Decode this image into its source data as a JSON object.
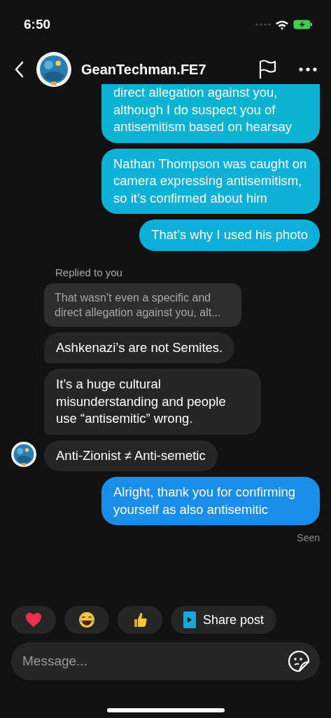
{
  "status_bar": {
    "time": "6:50"
  },
  "header": {
    "name": "GeanTechman.FE7"
  },
  "messages": [
    {
      "kind": "sent",
      "cut_off": true,
      "color": "#0bb3d3",
      "text": "direct allegation against you, although I do suspect you of antisemitism based on hearsay"
    },
    {
      "kind": "sent",
      "cut_off": false,
      "color": "#0bb1d6",
      "text": "Nathan Thompson was caught on camera expressing antisemitism, so it’s confirmed about him"
    },
    {
      "kind": "sent",
      "cut_off": false,
      "color": "#0bafd8",
      "text": "That’s why I used his photo"
    },
    {
      "kind": "reply_label",
      "text": "Replied to you"
    },
    {
      "kind": "reply_preview",
      "text": "That wasn’t even a specific and direct allegation against you, alt..."
    },
    {
      "kind": "received",
      "avatar": false,
      "text": "Ashkenazi’s are not Semites."
    },
    {
      "kind": "received",
      "avatar": false,
      "text": "It’s a huge cultural misunderstanding and people use “antisemitic” wrong."
    },
    {
      "kind": "received",
      "avatar": true,
      "text": "Anti-Zionist ≠ Anti-semetic"
    },
    {
      "kind": "sent",
      "cut_off": false,
      "color": "#1a8ee6",
      "text": "Alright, thank you for confirming yourself as also antisemitic"
    },
    {
      "kind": "status",
      "text": "Seen"
    }
  ],
  "quick_reactions": [
    {
      "kind": "heart"
    },
    {
      "kind": "laugh"
    },
    {
      "kind": "thumbs_up"
    },
    {
      "kind": "share",
      "label": "Share post"
    }
  ],
  "composer": {
    "placeholder": "Message..."
  }
}
